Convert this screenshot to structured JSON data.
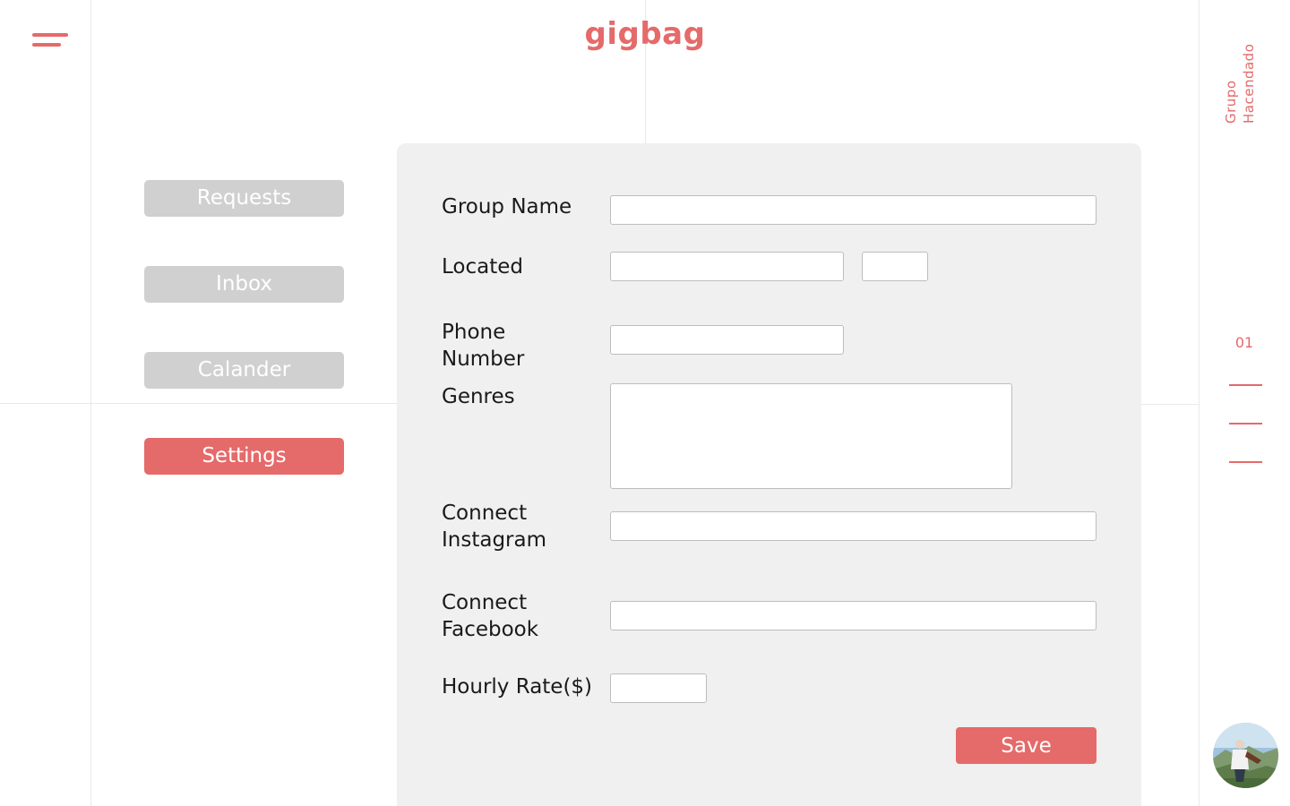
{
  "app": {
    "logo": "gigbag",
    "group_name": "Grupo Hacendado",
    "page_number": "01"
  },
  "colors": {
    "accent": "#e56a6a",
    "nav_inactive": "#d0d0d0",
    "panel": "#f0f0f0"
  },
  "icons": {
    "menu": "hamburger-menu-icon",
    "avatar": "profile-photo"
  },
  "nav": {
    "items": [
      {
        "label": "Requests",
        "active": false
      },
      {
        "label": "Inbox",
        "active": false
      },
      {
        "label": "Calander",
        "active": false
      },
      {
        "label": "Settings",
        "active": true
      }
    ]
  },
  "form": {
    "group_name_label": "Group Name",
    "located_label": "Located",
    "phone_label_1": "Phone",
    "phone_label_2": "Number",
    "genres_label": "Genres",
    "instagram_label_1": "Connect",
    "instagram_label_2": "Instagram",
    "facebook_label_1": "Connect",
    "facebook_label_2": "Facebook",
    "hourly_rate_label": "Hourly Rate($)",
    "values": {
      "group_name": "",
      "city": "",
      "state": "",
      "phone": "",
      "genres": "",
      "instagram": "",
      "facebook": "",
      "hourly_rate": ""
    },
    "save_label": "Save"
  }
}
